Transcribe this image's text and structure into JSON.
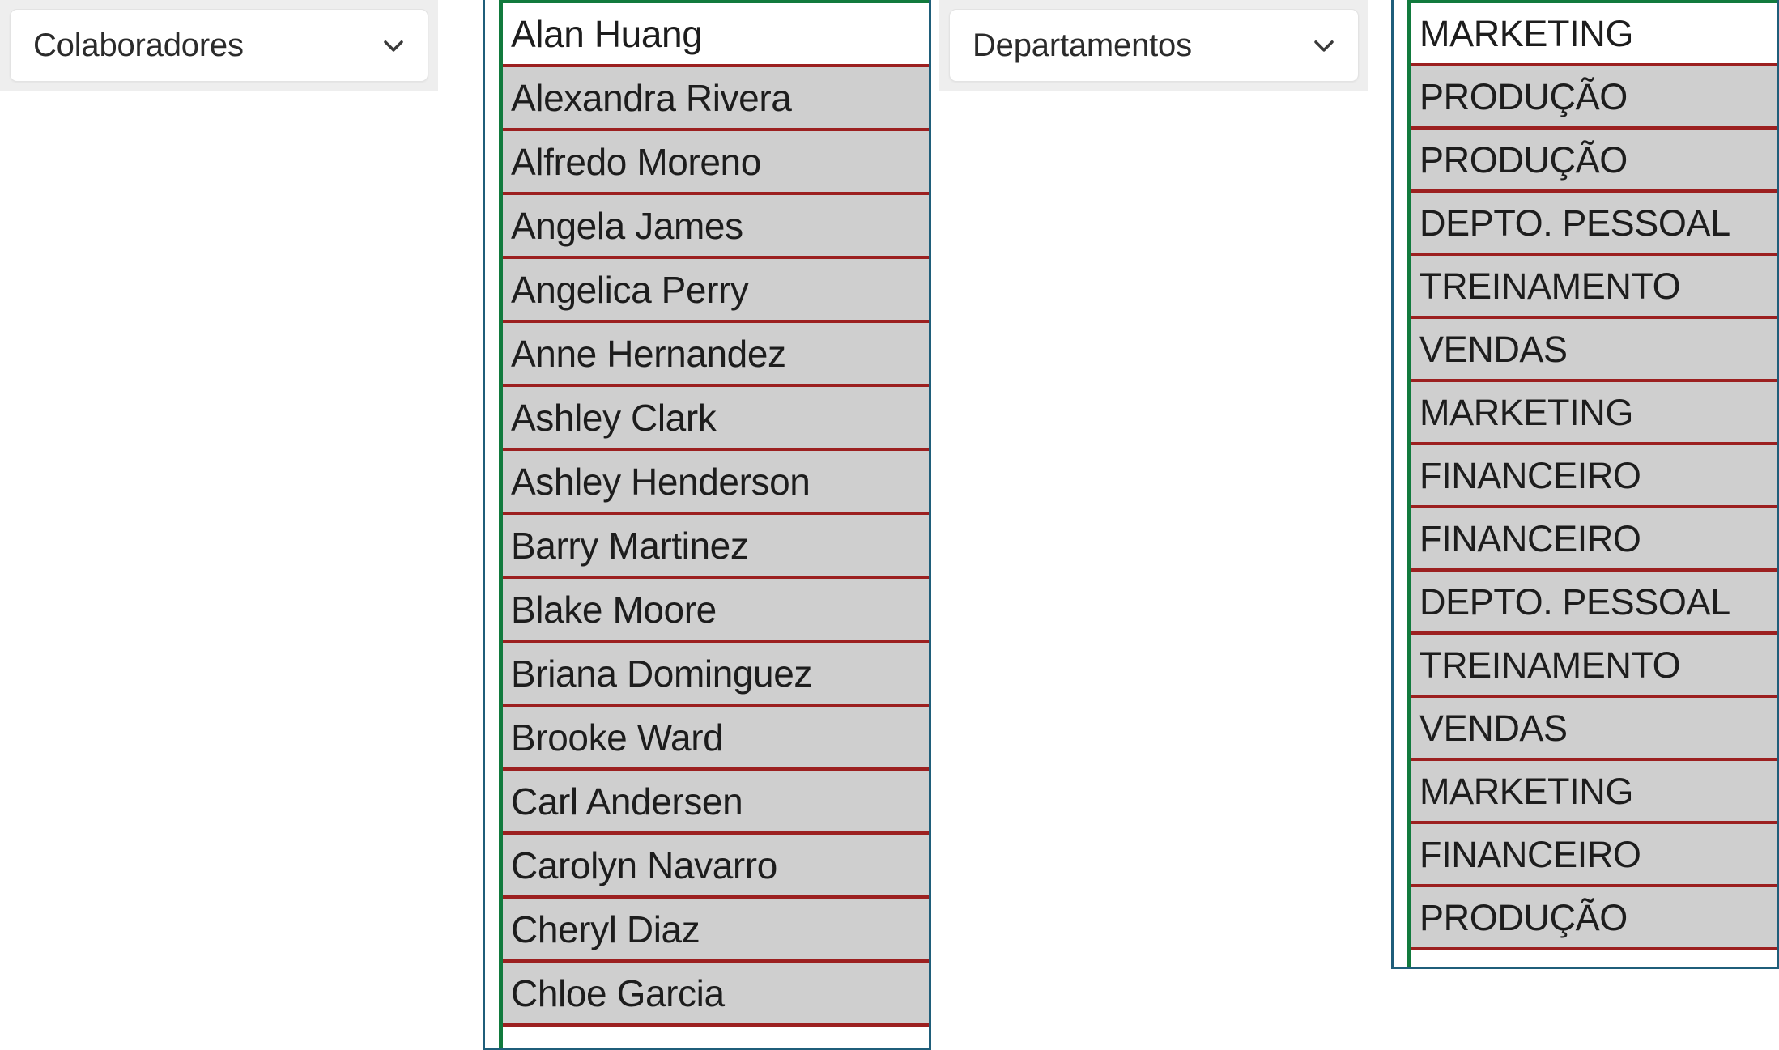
{
  "slicers": [
    {
      "id": "colaboradores",
      "label": "Colaboradores",
      "icon": "chevron-down-icon"
    },
    {
      "id": "departamentos",
      "label": "Departamentos",
      "icon": "chevron-down-icon"
    }
  ],
  "lists": [
    {
      "id": "colaboradores",
      "selected_index": 0,
      "border_color": "#1f5e7a",
      "accent_color": "#117a3d",
      "separator_color": "#9c2020",
      "row_color": "#cfcfcf",
      "selected_row_color": "#ffffff",
      "items": [
        "Alan Huang",
        "Alexandra Rivera",
        "Alfredo Moreno",
        "Angela James",
        "Angelica Perry",
        "Anne Hernandez",
        "Ashley Clark",
        "Ashley Henderson",
        "Barry Martinez",
        "Blake Moore",
        "Briana Dominguez",
        "Brooke Ward",
        "Carl Andersen",
        "Carolyn Navarro",
        "Cheryl Diaz",
        "Chloe Garcia"
      ]
    },
    {
      "id": "departamentos",
      "selected_index": 0,
      "border_color": "#1f5e7a",
      "accent_color": "#117a3d",
      "separator_color": "#9c2020",
      "row_color": "#cfcfcf",
      "selected_row_color": "#ffffff",
      "items": [
        "MARKETING",
        "PRODUÇÃO",
        "PRODUÇÃO",
        "DEPTO. PESSOAL",
        "TREINAMENTO",
        "VENDAS",
        "MARKETING",
        "FINANCEIRO",
        "FINANCEIRO",
        "DEPTO. PESSOAL",
        "TREINAMENTO",
        "VENDAS",
        "MARKETING",
        "FINANCEIRO",
        "PRODUÇÃO"
      ]
    }
  ]
}
